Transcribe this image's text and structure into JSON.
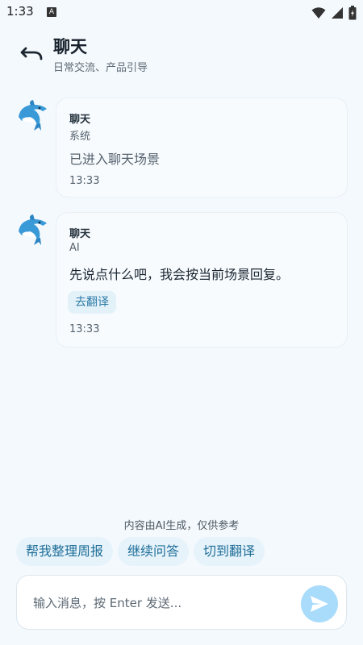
{
  "status": {
    "time": "1:33",
    "notif_letter": "A"
  },
  "header": {
    "title": "聊天",
    "subtitle": "日常交流、产品引导"
  },
  "messages": [
    {
      "sender": "聊天",
      "role": "系统",
      "text": "已进入聊天场景",
      "time": "13:33"
    },
    {
      "sender": "聊天",
      "role": "AI",
      "text": "先说点什么吧，我会按当前场景回复。",
      "action": "去翻译",
      "time": "13:33"
    }
  ],
  "disclaimer": "内容由AI生成，仅供参考",
  "quick_replies": [
    "帮我整理周报",
    "继续问答",
    "切到翻译"
  ],
  "composer": {
    "placeholder": "输入消息，按 Enter 发送..."
  },
  "colors": {
    "background": "#f4f9fd",
    "chip_bg": "#e6f3fa",
    "chip_text": "#1f6e99",
    "send_button": "#a9dcfa"
  },
  "icons": {
    "back": "undo-arrow-icon",
    "avatar": "dolphin-avatar-icon",
    "send": "paper-plane-icon"
  }
}
